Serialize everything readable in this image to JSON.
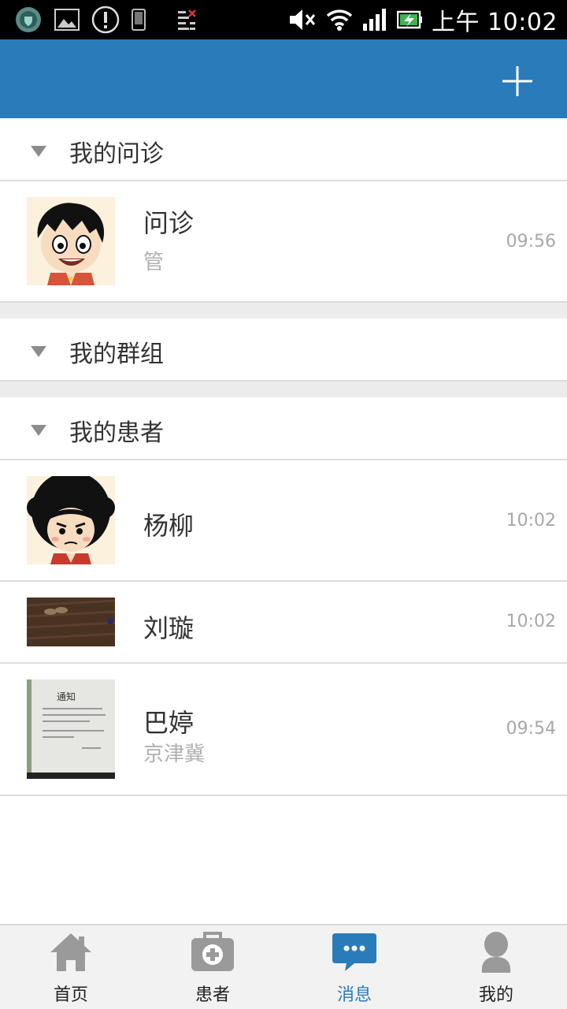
{
  "status_bar": {
    "time": "上午 10:02",
    "icons": [
      "shield-app-icon",
      "image-icon",
      "alert-icon",
      "phone-icon",
      "data-icon",
      "mute-icon",
      "wifi-icon",
      "signal-icon",
      "battery-icon"
    ]
  },
  "app_bar": {
    "action_icon": "plus-icon"
  },
  "sections": {
    "consult": {
      "title": "我的问诊",
      "items": [
        {
          "name": "问诊",
          "sub": "管",
          "time": "09:56",
          "avatar": "cartoon-boy-avatar"
        }
      ]
    },
    "groups": {
      "title": "我的群组"
    },
    "patients": {
      "title": "我的患者",
      "items": [
        {
          "name": "杨柳",
          "sub": "",
          "time": "10:02",
          "avatar": "cartoon-afro-avatar"
        },
        {
          "name": "刘璇",
          "sub": "",
          "time": "10:02",
          "avatar": "floor-photo-avatar"
        },
        {
          "name": "巴婷",
          "sub": "京津冀",
          "time": "09:54",
          "avatar": "notice-paper-avatar"
        }
      ]
    }
  },
  "avatar_thumb_text": "通知",
  "bottom_nav": {
    "items": [
      {
        "label": "首页",
        "icon": "home-icon"
      },
      {
        "label": "患者",
        "icon": "medical-kit-icon"
      },
      {
        "label": "消息",
        "icon": "chat-bubble-icon"
      },
      {
        "label": "我的",
        "icon": "person-icon"
      }
    ],
    "active_index": 2
  },
  "colors": {
    "primary": "#2a7bb9",
    "nav_icon_inactive": "#9a9a9a",
    "divider": "#dcdcdc"
  }
}
